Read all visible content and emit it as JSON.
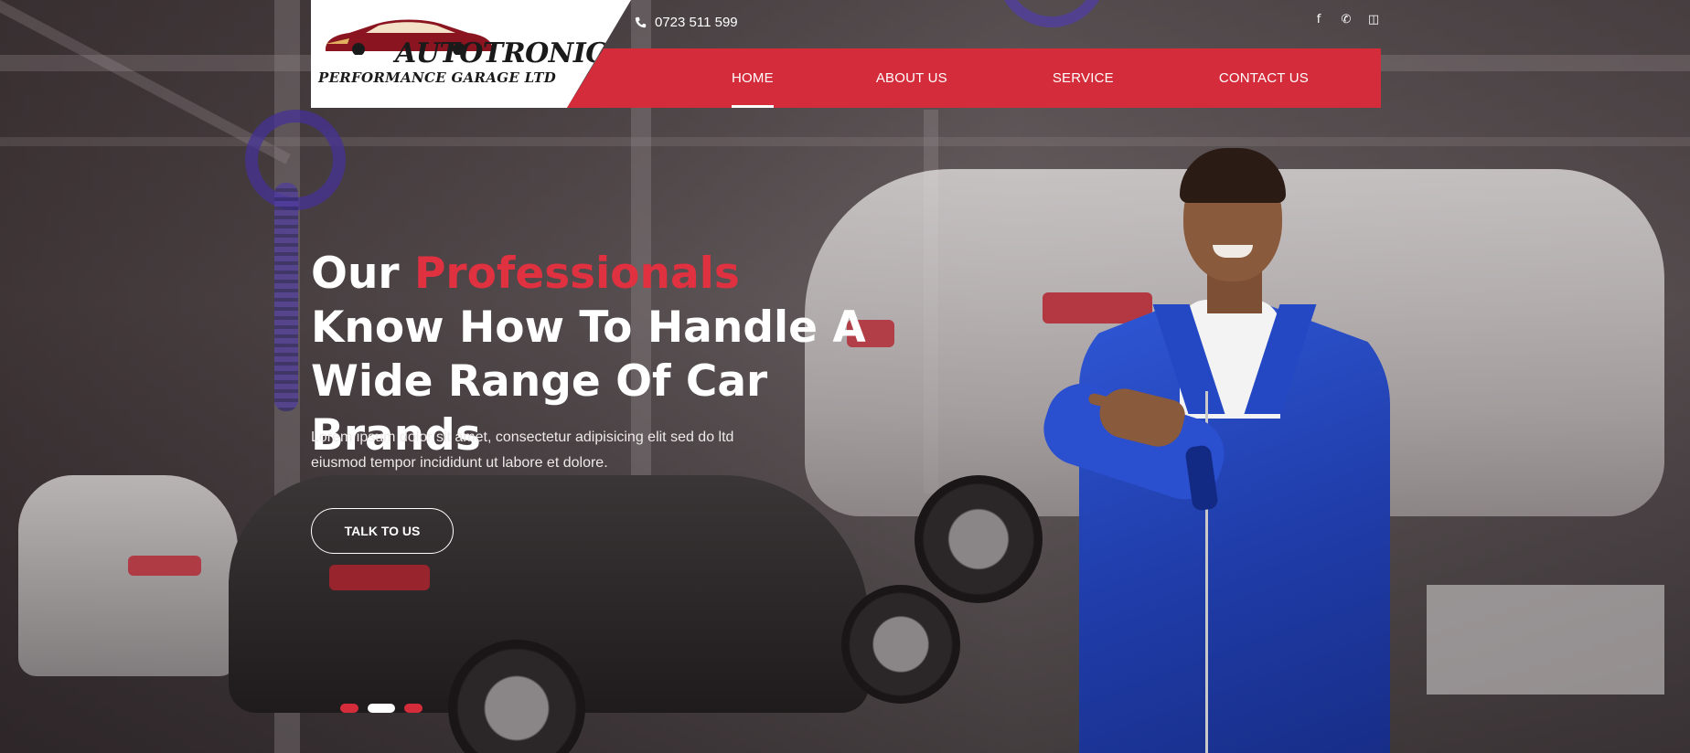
{
  "brand": {
    "logo_title": "AUTOTRONICS",
    "logo_subtitle": "PERFORMANCE GARAGE LTD",
    "accent_color": "#d42c3b"
  },
  "topbar": {
    "phone_icon": "phone-icon",
    "phone": "0723 511 599",
    "socials": [
      {
        "name": "facebook-icon",
        "glyph": "f"
      },
      {
        "name": "whatsapp-icon",
        "glyph": "✆"
      },
      {
        "name": "instagram-icon",
        "glyph": "◫"
      }
    ]
  },
  "nav": {
    "items": [
      {
        "label": "HOME",
        "active": true
      },
      {
        "label": "ABOUT US",
        "active": false
      },
      {
        "label": "SERVICE",
        "active": false
      },
      {
        "label": "CONTACT US",
        "active": false
      }
    ]
  },
  "hero": {
    "heading_part1": "Our ",
    "heading_accent": "Professionals",
    "heading_part2": " Know How To Handle A Wide Range Of Car Brands",
    "paragraph": "Lorem ipsum dolor sit amet, consectetur adipisicing elit sed do ltd eiusmod tempor incididunt ut labore et dolore.",
    "cta_label": "TALK TO US"
  },
  "slider": {
    "total_slides": 3,
    "active_index": 2
  }
}
